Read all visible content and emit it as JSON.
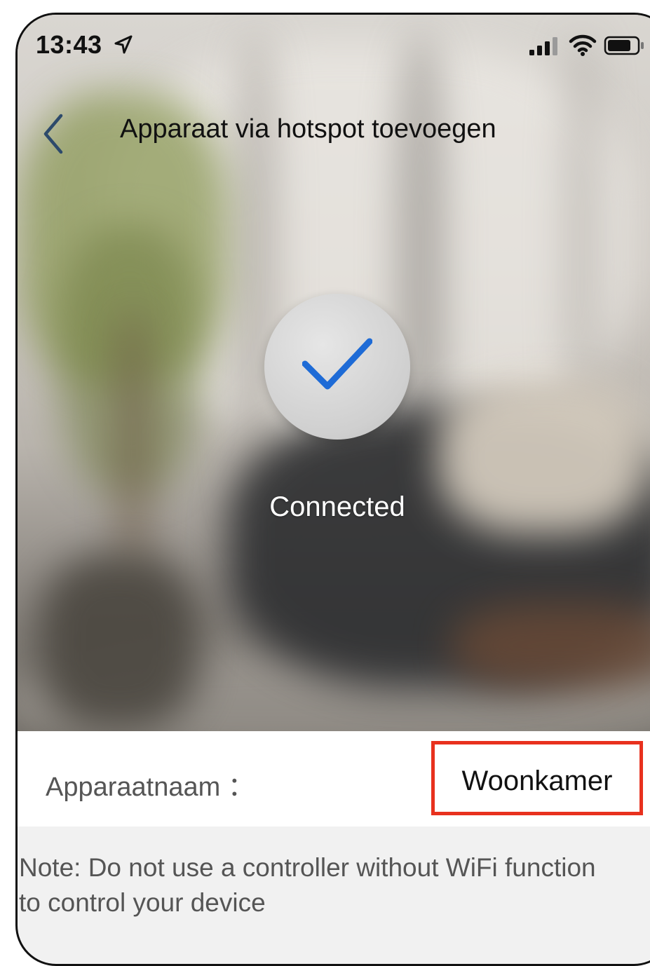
{
  "status_bar": {
    "time": "13:43"
  },
  "nav": {
    "title": "Apparaat via hotspot toevoegen"
  },
  "result": {
    "status": "Connected"
  },
  "device": {
    "name_label": "Apparaatnaam ：",
    "name_value": "Woonkamer"
  },
  "note": {
    "text": "Note: Do not use a controller without WiFi function to control your device"
  },
  "colors": {
    "check": "#1e6bd6",
    "highlight": "#e8311e"
  }
}
